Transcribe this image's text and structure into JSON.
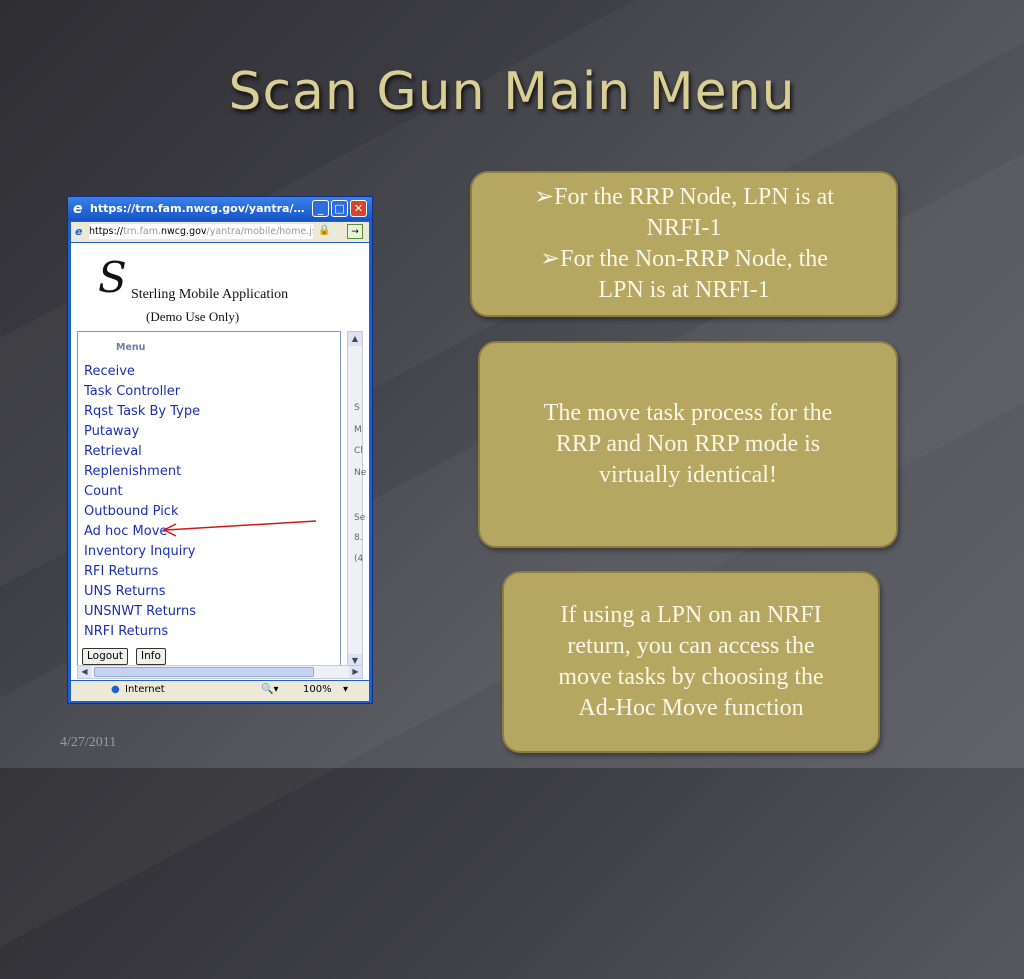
{
  "slide": {
    "title": "Scan Gun Main Menu",
    "date": "4/27/2011"
  },
  "browser": {
    "window_title": "https://trn.fam.nwcg.gov/yantra/mob...",
    "address_prefix": "https://",
    "address_dim1": "trn.fam.",
    "address_host": "nwcg.gov",
    "address_path": "/yantra/mobile/home.jsp",
    "app_name": "Sterling Mobile Application",
    "app_subtitle": "(Demo Use Only)",
    "menu_heading": "Menu",
    "menu_items": [
      "Receive",
      "Task Controller",
      "Rqst Task By Type",
      "Putaway",
      "Retrieval",
      "Replenishment",
      "Count",
      "Outbound Pick",
      "Ad hoc Move",
      "Inventory Inquiry",
      "RFI Returns",
      "UNS Returns",
      "UNSNWT Returns",
      "NRFI Returns"
    ],
    "logout_label": "Logout",
    "info_label": "Info",
    "right_col": [
      "S",
      "M",
      "Cl",
      "Ne",
      "Se",
      "8.",
      "(4"
    ],
    "status_zone": "Internet",
    "status_zoom": "100%"
  },
  "callouts": {
    "box1_lines": [
      "➢For the RRP Node, LPN is at",
      "NRFI-1",
      "➢For the Non-RRP Node, the",
      "LPN is at NRFI-1"
    ],
    "box2_lines": [
      "The move task process for the",
      "RRP and Non RRP mode is",
      "virtually identical!"
    ],
    "box3_lines": [
      "If using a LPN on an NRFI",
      "return, you can access the",
      "move tasks by choosing the",
      "Ad-Hoc Move function"
    ]
  },
  "colors": {
    "title": "#d9cf94",
    "callout_fill": "#b5a662",
    "menu_link": "#1a2fb8",
    "arrow": "#d01818"
  },
  "icons": [
    "ie-icon",
    "minimize-icon",
    "maximize-icon",
    "close-icon",
    "lock-icon",
    "go-icon",
    "sterling-logo-icon",
    "globe-icon",
    "zoom-icon"
  ]
}
